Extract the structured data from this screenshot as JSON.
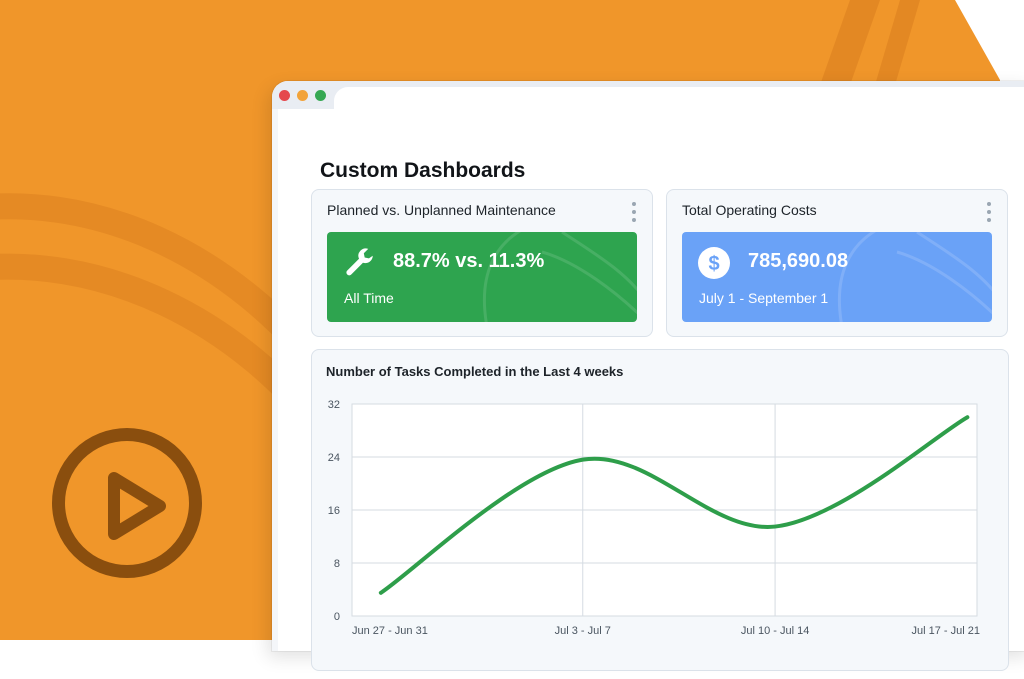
{
  "page": {
    "title": "Custom Dashboards"
  },
  "colors": {
    "brand_orange": "#F0962A",
    "play_brown": "#8A4E0E",
    "tile_green": "#2EA44F",
    "tile_blue": "#6AA2F7",
    "line_green": "#2E9E4A"
  },
  "window_controls": [
    "close",
    "minimize",
    "maximize"
  ],
  "widgets": {
    "maintenance": {
      "title": "Planned vs. Unplanned Maintenance",
      "icon": "wrench-icon",
      "value": "88.7% vs. 11.3%",
      "subtitle": "All Time"
    },
    "costs": {
      "title": "Total Operating Costs",
      "icon": "dollar-icon",
      "value": "785,690.08",
      "subtitle": "July 1 - September 1"
    }
  },
  "chart": {
    "title": "Number of Tasks Completed in the Last 4 weeks"
  },
  "chart_data": {
    "type": "line",
    "title": "Number of Tasks Completed in the Last 4 weeks",
    "categories": [
      "Jun 27 - Jun 31",
      "Jul 3 - Jul 7",
      "Jul 10 - Jul 14",
      "Jul 17 - Jul 21"
    ],
    "x": [
      -0.05,
      1,
      2,
      3
    ],
    "y_ticks": [
      0,
      8,
      16,
      24,
      32
    ],
    "ylim": [
      0,
      32
    ],
    "xlabel": "",
    "ylabel": "",
    "grid": true,
    "legend": "none",
    "series": [
      {
        "values": [
          3.5,
          23.6,
          13.5,
          30
        ]
      }
    ]
  }
}
